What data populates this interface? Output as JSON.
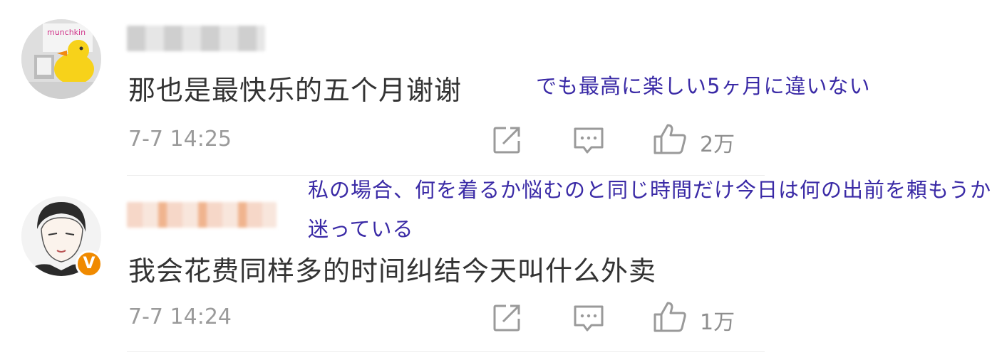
{
  "comments": [
    {
      "text": "那也是最快乐的五个月谢谢",
      "translation": "でも最高に楽しい5ヶ月に違いない",
      "timestamp": "7-7 14:25",
      "likes": "2万",
      "avatar_brand": "munchkin"
    },
    {
      "text": "我会花费同样多的时间纠结今天叫什么外卖",
      "translation": "私の場合、何を着るか悩むのと同じ時間だけ今日は何の出前を頼もうか迷っている",
      "timestamp": "7-7 14:24",
      "likes": "1万",
      "verified_badge": "V"
    }
  ],
  "icons": {
    "share": "share-icon",
    "comment": "comment-icon",
    "like": "thumbs-up-icon"
  },
  "colors": {
    "translation": "#3a2aa6",
    "meta": "#9a9a9a",
    "badge": "#f08a00"
  }
}
